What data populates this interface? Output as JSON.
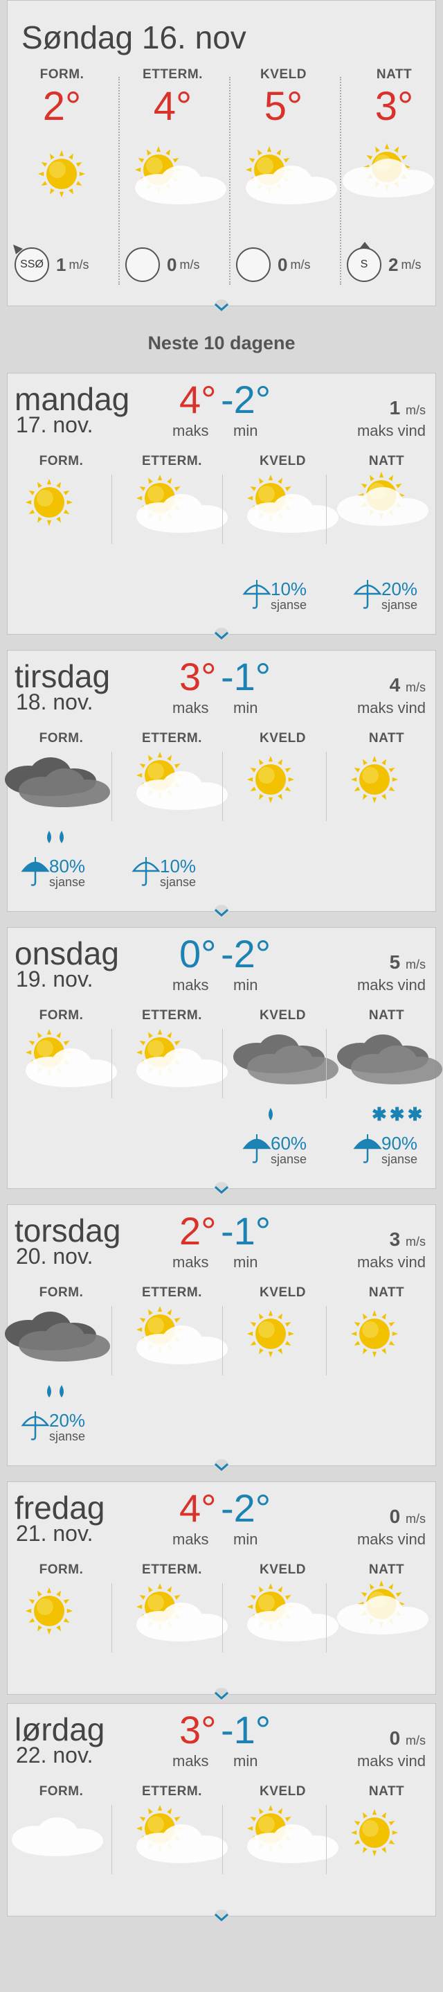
{
  "colors": {
    "warm": "#d9322b",
    "cold": "#1c82b4",
    "text": "#555555",
    "sun": "#f2c200",
    "rain": "#1c82b4"
  },
  "today": {
    "title": "Søndag 16. nov",
    "periods": [
      {
        "label": "FORM.",
        "temp": "2°",
        "icon": "sun-icon",
        "wind_dir": "SSØ",
        "wind": "1",
        "unit": "m/s"
      },
      {
        "label": "ETTERM.",
        "temp": "4°",
        "icon": "sun-cloud-icon",
        "wind_dir": "",
        "wind": "0",
        "unit": "m/s"
      },
      {
        "label": "KVELD",
        "temp": "5°",
        "icon": "sun-cloud-icon",
        "wind_dir": "",
        "wind": "0",
        "unit": "m/s"
      },
      {
        "label": "NATT",
        "temp": "3°",
        "icon": "cloud-sun-icon",
        "wind_dir": "S",
        "wind": "2",
        "unit": "m/s"
      }
    ]
  },
  "section_title": "Neste 10 dagene",
  "labels": {
    "max": "maks",
    "min": "min",
    "max_wind": "maks vind",
    "unit": "m/s",
    "chance": "sjanse"
  },
  "days": [
    {
      "name": "mandag",
      "date": "17. nov.",
      "max": "4°",
      "min": "-2°",
      "max_color": "#d9322b",
      "wind": "1",
      "periods": [
        "FORM.",
        "ETTERM.",
        "KVELD",
        "NATT"
      ],
      "icons": [
        "sun-icon",
        "sun-cloud-icon",
        "sun-cloud-icon",
        "cloud-sun-icon"
      ],
      "chances": [
        null,
        null,
        "10%",
        "20%"
      ],
      "drops": [
        0,
        0,
        0,
        0
      ],
      "snow": [
        false,
        false,
        false,
        false
      ]
    },
    {
      "name": "tirsdag",
      "date": "18. nov.",
      "max": "3°",
      "min": "-1°",
      "max_color": "#d9322b",
      "wind": "4",
      "periods": [
        "FORM.",
        "ETTERM.",
        "KVELD",
        "NATT"
      ],
      "icons": [
        "rain-cloud-icon",
        "sun-cloud-icon",
        "sun-icon",
        "sun-icon"
      ],
      "chances": [
        "80%",
        "10%",
        null,
        null
      ],
      "drops": [
        2,
        0,
        0,
        0
      ],
      "snow": [
        false,
        false,
        false,
        false
      ]
    },
    {
      "name": "onsdag",
      "date": "19. nov.",
      "max": "0°",
      "min": "-2°",
      "max_color": "#1c82b4",
      "wind": "5",
      "periods": [
        "FORM.",
        "ETTERM.",
        "KVELD",
        "NATT"
      ],
      "icons": [
        "sun-cloud-icon",
        "sun-cloud-icon",
        "dark-cloud-icon",
        "dark-cloud-icon"
      ],
      "chances": [
        null,
        null,
        "60%",
        "90%"
      ],
      "drops": [
        0,
        0,
        1,
        0
      ],
      "snow": [
        false,
        false,
        false,
        true
      ]
    },
    {
      "name": "torsdag",
      "date": "20. nov.",
      "max": "2°",
      "min": "-1°",
      "max_color": "#d9322b",
      "wind": "3",
      "periods": [
        "FORM.",
        "ETTERM.",
        "KVELD",
        "NATT"
      ],
      "icons": [
        "rain-cloud-icon",
        "sun-cloud-icon",
        "sun-icon",
        "sun-icon"
      ],
      "chances": [
        "20%",
        null,
        null,
        null
      ],
      "drops": [
        2,
        0,
        0,
        0
      ],
      "snow": [
        false,
        false,
        false,
        false
      ]
    },
    {
      "name": "fredag",
      "date": "21. nov.",
      "max": "4°",
      "min": "-2°",
      "max_color": "#d9322b",
      "wind": "0",
      "periods": [
        "FORM.",
        "ETTERM.",
        "KVELD",
        "NATT"
      ],
      "icons": [
        "sun-icon",
        "sun-cloud-icon",
        "sun-cloud-icon",
        "cloud-sun-icon"
      ],
      "chances": [
        null,
        null,
        null,
        null
      ],
      "drops": [
        0,
        0,
        0,
        0
      ],
      "snow": [
        false,
        false,
        false,
        false
      ]
    },
    {
      "name": "lørdag",
      "date": "22. nov.",
      "max": "3°",
      "min": "-1°",
      "max_color": "#d9322b",
      "wind": "0",
      "periods": [
        "FORM.",
        "ETTERM.",
        "KVELD",
        "NATT"
      ],
      "icons": [
        "cloud-icon",
        "sun-cloud-icon",
        "sun-cloud-icon",
        "sun-icon"
      ],
      "chances": [
        null,
        null,
        null,
        null
      ],
      "drops": [
        0,
        0,
        0,
        0
      ],
      "snow": [
        false,
        false,
        false,
        false
      ]
    }
  ]
}
